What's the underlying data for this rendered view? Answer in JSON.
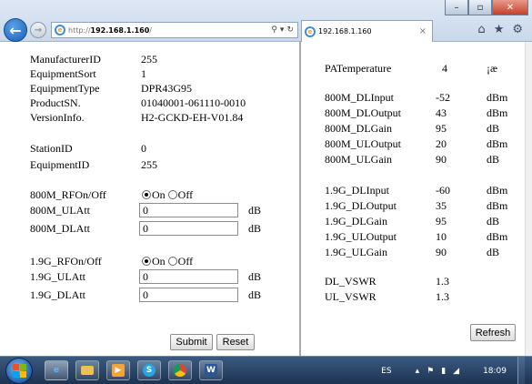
{
  "browser": {
    "address": {
      "protocol": "http://",
      "host": "192.168.1.160",
      "path": "/"
    },
    "tab_title": "192.168.1.160",
    "addr_actions": [
      "⚲",
      "▾",
      "↻"
    ],
    "tab_close": "×",
    "window_controls": [
      "–",
      "▫",
      "✕"
    ],
    "toolbar_icons": [
      "⌂",
      "★",
      "⚙"
    ]
  },
  "left": {
    "info": [
      {
        "label": "ManufacturerID",
        "value": "255"
      },
      {
        "label": "EquipmentSort",
        "value": "1"
      },
      {
        "label": "EquipmentType",
        "value": "DPR43G95"
      },
      {
        "label": "ProductSN.",
        "value": "01040001-061110-0010"
      },
      {
        "label": "VersionInfo.",
        "value": "H2-GCKD-EH-V01.84"
      }
    ],
    "station": [
      {
        "label": "StationID",
        "value": "0"
      },
      {
        "label": "EquipmentID",
        "value": "255"
      }
    ],
    "band800": {
      "rf_label": "800M_RFOn/Off",
      "on_label": "On",
      "off_label": "Off",
      "rf_state": "On",
      "ul_label": "800M_ULAtt",
      "ul_value": "0",
      "ul_unit": "dB",
      "dl_label": "800M_DLAtt",
      "dl_value": "0",
      "dl_unit": "dB"
    },
    "band19": {
      "rf_label": "1.9G_RFOn/Off",
      "on_label": "On",
      "off_label": "Off",
      "rf_state": "On",
      "ul_label": "1.9G_ULAtt",
      "ul_value": "0",
      "ul_unit": "dB",
      "dl_label": "1.9G_DLAtt",
      "dl_value": "0",
      "dl_unit": "dB"
    },
    "submit_label": "Submit",
    "reset_label": "Reset"
  },
  "right": {
    "pa_temperature": {
      "label": "PATemperature",
      "value": "4",
      "unit": "¡æ"
    },
    "m800": [
      {
        "label": "800M_DLInput",
        "value": "-52",
        "unit": "dBm"
      },
      {
        "label": "800M_DLOutput",
        "value": "43",
        "unit": "dBm"
      },
      {
        "label": "800M_DLGain",
        "value": "95",
        "unit": "dB"
      },
      {
        "label": "800M_ULOutput",
        "value": "20",
        "unit": "dBm"
      },
      {
        "label": "800M_ULGain",
        "value": "90",
        "unit": "dB"
      }
    ],
    "g19": [
      {
        "label": "1.9G_DLInput",
        "value": "-60",
        "unit": "dBm"
      },
      {
        "label": "1.9G_DLOutput",
        "value": "35",
        "unit": "dBm"
      },
      {
        "label": "1.9G_DLGain",
        "value": "95",
        "unit": "dB"
      },
      {
        "label": "1.9G_ULOutput",
        "value": "10",
        "unit": "dBm"
      },
      {
        "label": "1.9G_ULGain",
        "value": "90",
        "unit": "dB"
      }
    ],
    "vswr": [
      {
        "label": "DL_VSWR",
        "value": "1.3"
      },
      {
        "label": "UL_VSWR",
        "value": "1.3"
      }
    ],
    "refresh_label": "Refresh"
  },
  "taskbar": {
    "apps": [
      "e",
      "",
      "▶",
      "S",
      "",
      "W"
    ],
    "language": "ES",
    "tray_icons": [
      "▴",
      "⚑",
      "▮",
      "◢"
    ],
    "clock": "18:09"
  }
}
